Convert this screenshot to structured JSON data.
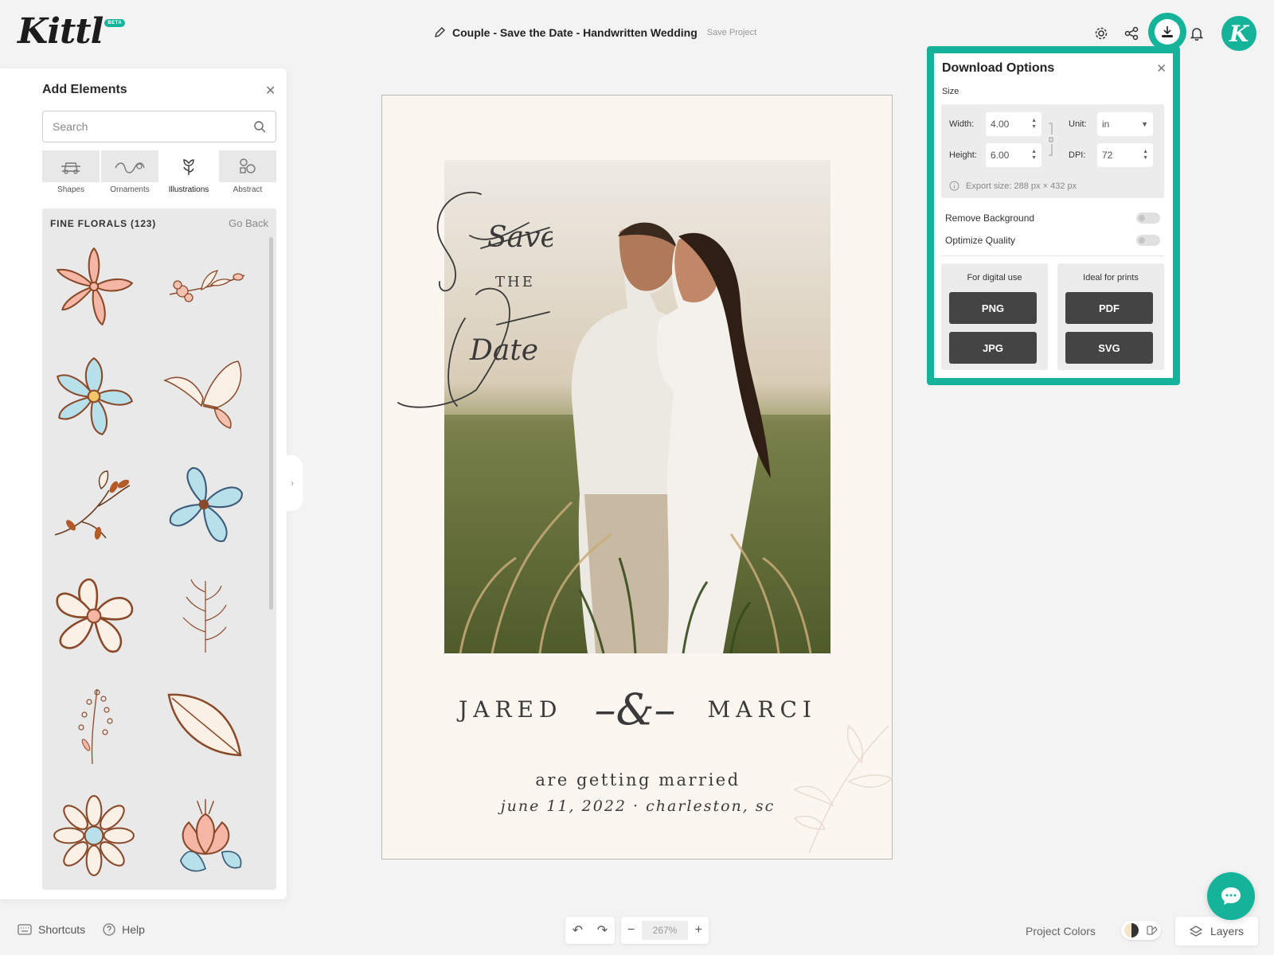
{
  "header": {
    "logo": "Kittl",
    "beta_badge": "BETA",
    "project_title": "Couple - Save the Date - Handwritten Wedding",
    "save_project": "Save Project",
    "avatar_letter": "K",
    "icons": [
      "gear-icon",
      "share-icon",
      "download-icon",
      "bell-icon"
    ]
  },
  "rail": {
    "icons": [
      "edit-icon",
      "templates-icon",
      "text-icon",
      "elements-icon",
      "upload-icon",
      "camera-icon",
      "grid-dots-icon"
    ]
  },
  "add_elements": {
    "title": "Add Elements",
    "search_placeholder": "Search",
    "categories": [
      {
        "label": "Shapes",
        "icon": "shapes-icon"
      },
      {
        "label": "Ornaments",
        "icon": "ornaments-icon"
      },
      {
        "label": "Illustrations",
        "icon": "illustrations-icon"
      },
      {
        "label": "Abstract",
        "icon": "abstract-icon"
      }
    ],
    "collection_title": "FINE FLORALS (123)",
    "go_back": "Go Back"
  },
  "canvas": {
    "script_line1": "Save",
    "script_the": "THE",
    "script_line2": "Date",
    "name_left": "JARED",
    "ampersand": "–&–",
    "name_right": "MARCI",
    "married": "are getting married",
    "date_place": "june 11, 2022 · charleston, sc"
  },
  "download": {
    "title": "Download Options",
    "size_label": "Size",
    "width_label": "Width:",
    "width_value": "4.00",
    "height_label": "Height:",
    "height_value": "6.00",
    "unit_label": "Unit:",
    "unit_value": "in",
    "dpi_label": "DPI:",
    "dpi_value": "72",
    "export_size": "Export size: 288 px × 432 px",
    "remove_bg": "Remove Background",
    "optimize": "Optimize Quality",
    "digital_head": "For digital use",
    "print_head": "Ideal for prints",
    "png": "PNG",
    "jpg": "JPG",
    "pdf": "PDF",
    "svg": "SVG"
  },
  "bottom": {
    "shortcuts": "Shortcuts",
    "help": "Help",
    "zoom": "267%",
    "project_colors": "Project Colors",
    "layers": "Layers"
  },
  "colors": {
    "accent": "#16b39b",
    "dark_button": "#444444",
    "artboard": "#fbf6f0"
  }
}
